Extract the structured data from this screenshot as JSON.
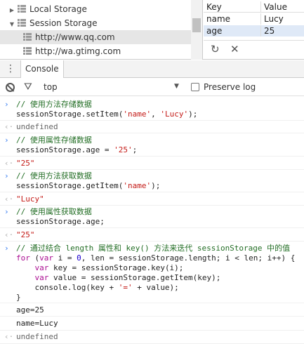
{
  "storage_tree": {
    "local_storage_label": "Local Storage",
    "session_storage_label": "Session Storage",
    "origins": [
      "http://www.qq.com",
      "http://wa.gtimg.com"
    ]
  },
  "kv_table": {
    "key_header": "Key",
    "value_header": "Value",
    "rows": [
      {
        "key": "name",
        "value": "Lucy"
      },
      {
        "key": "age",
        "value": "25"
      }
    ],
    "refresh_icon": "↻",
    "delete_icon": "✕"
  },
  "tabs": {
    "menu_icon": "⋮",
    "console_label": "Console"
  },
  "toolbar": {
    "filter_icon": "⛛",
    "context_value": "top",
    "context_arrow": "▼",
    "preserve_log_label": "Preserve log"
  },
  "console": {
    "input_prompt": "›",
    "output_prompt": "‹·",
    "e1_comment": "// 使用方法存储数据",
    "e1_code": [
      "sessionStorage.setItem(",
      "'name'",
      ", ",
      "'Lucy'",
      ");"
    ],
    "e1_result": "undefined",
    "e2_comment": "// 使用属性存储数据",
    "e2_code": [
      "sessionStorage.age = ",
      "'25'",
      ";"
    ],
    "e2_result": "\"25\"",
    "e3_comment": "// 使用方法获取数据",
    "e3_code": [
      "sessionStorage.getItem(",
      "'name'",
      ");"
    ],
    "e3_result": "\"Lucy\"",
    "e4_comment": "// 使用属性获取数据",
    "e4_code": "sessionStorage.age;",
    "e4_result": "\"25\"",
    "e5_comment": "// 通过结合 length 属性和 key() 方法来迭代 sessionStorage 中的值",
    "e5_for": [
      "for",
      " (",
      "var",
      " i = ",
      "0",
      ", len = sessionStorage.length; i < len; i++) {"
    ],
    "e5_l2": [
      "    ",
      "var",
      " key = sessionStorage.key(i);"
    ],
    "e5_l3": [
      "    ",
      "var",
      " value = sessionStorage.getItem(key);"
    ],
    "e5_l4": [
      "    console.log(key + ",
      "'='",
      " + value);"
    ],
    "e5_l5": "}",
    "log1": "age=25",
    "log2": "name=Lucy",
    "final_result": "undefined"
  }
}
